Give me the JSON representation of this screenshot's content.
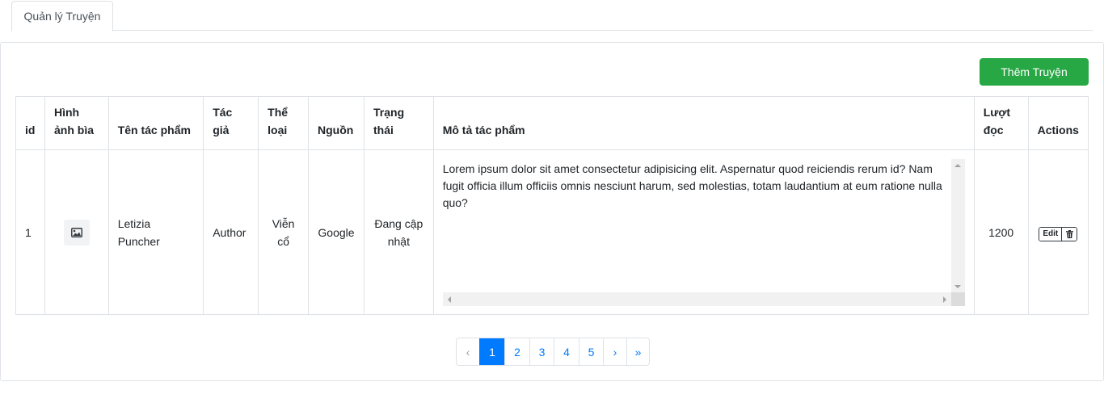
{
  "tabs": [
    {
      "label": "Quản lý Truyện"
    }
  ],
  "toolbar": {
    "add_label": "Thêm Truyện",
    "add_color": "#28a745"
  },
  "table": {
    "headers": {
      "id": "id",
      "cover": "Hình ảnh bìa",
      "title": "Tên tác phẩm",
      "author": "Tác giả",
      "genre": "Thể loại",
      "source": "Nguồn",
      "status": "Trạng thái",
      "description": "Mô tả tác phẩm",
      "views": "Lượt đọc",
      "actions": "Actions"
    },
    "rows": [
      {
        "id": "1",
        "cover_icon": "image-icon",
        "title": "Letizia Puncher",
        "author": "Author",
        "genre": "Viễn cổ",
        "source": "Google",
        "status": "Đang cập nhật",
        "description": "Lorem ipsum dolor sit amet consectetur adipisicing elit. Aspernatur quod reiciendis rerum id? Nam fugit officia illum officiis omnis nesciunt harum, sed molestias, totam laudantium at eum ratione nulla quo?",
        "views": "1200",
        "edit_label": "Edit",
        "delete_icon": "trash-icon"
      }
    ]
  },
  "pagination": {
    "prev": "‹",
    "pages": [
      "1",
      "2",
      "3",
      "4",
      "5"
    ],
    "active": "1",
    "next": "›",
    "last": "»",
    "active_color": "#007bff"
  }
}
